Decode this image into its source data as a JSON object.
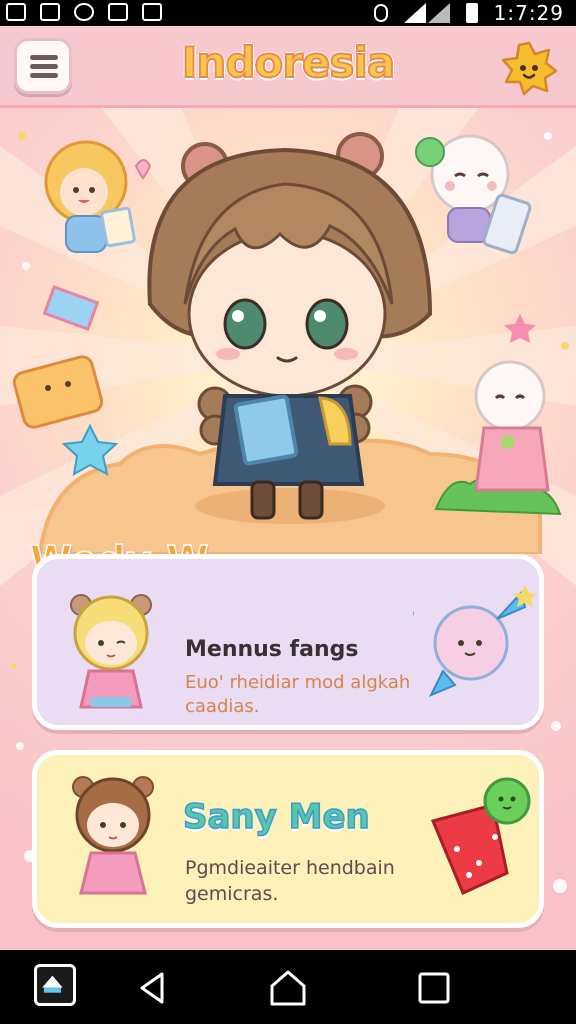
{
  "status_bar": {
    "time": "1:7:29",
    "icons": [
      "notification-icon",
      "image-icon",
      "fire-icon",
      "no-sim-icon",
      "chart-icon",
      "vibrate-icon",
      "signal-icon",
      "battery-icon"
    ]
  },
  "header": {
    "title": "Indoresia",
    "menu_icon": "hamburger-menu-icon",
    "mascot_icon": "star-mascot-icon"
  },
  "hero": {
    "description": "chibi girl character holding a book with friends"
  },
  "section": {
    "tag_text": "Wedy W"
  },
  "cards": [
    {
      "title": "Mennus fangs",
      "description": "Euo' rheidiar mod algkah caadias."
    },
    {
      "title": "Sany Men",
      "description": "Pgmdieaiter hendbain gemicras."
    }
  ],
  "nav_bar": {
    "icons": [
      "app-launcher-icon",
      "back-icon",
      "home-icon",
      "recents-icon"
    ]
  },
  "colors": {
    "header_bg": "#f8c8cf",
    "title_fill": "#f8c64a",
    "card1_bg": "#e9dcf3",
    "card2_bg": "#fbf1b9",
    "accent_teal": "#59c7a7"
  }
}
